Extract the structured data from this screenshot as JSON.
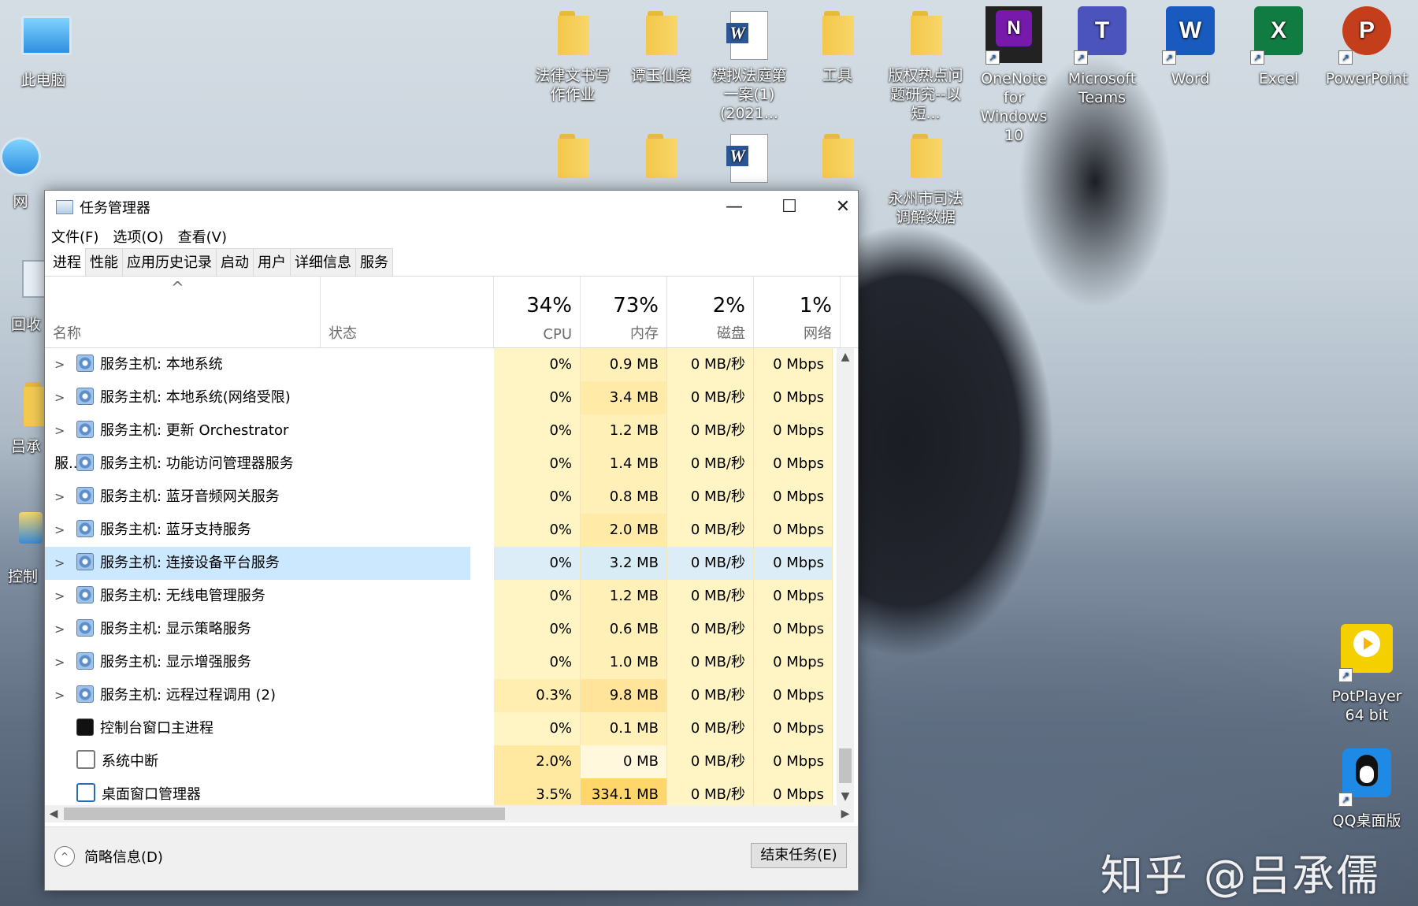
{
  "desktop": {
    "icons_left": [
      {
        "label": "此电脑"
      },
      {
        "label": "网"
      },
      {
        "label": "回收"
      },
      {
        "label": "吕承"
      },
      {
        "label": "控制"
      }
    ],
    "icons_top": [
      {
        "label": "法律文书写作作业",
        "type": "folder"
      },
      {
        "label": "谭玉仙案",
        "type": "folder"
      },
      {
        "label": "模拟法庭第一案(1) (2021...",
        "type": "word-doc"
      },
      {
        "label": "工具",
        "type": "folder"
      },
      {
        "label": "版权热点问题研究--以短...",
        "type": "folder"
      }
    ],
    "icons_row2": [
      {
        "label": "永州市司法调解数据",
        "type": "folder"
      }
    ],
    "apps": [
      {
        "label": "OneNote for Windows 10",
        "letter": "N",
        "color": "#7719aa"
      },
      {
        "label": "Microsoft Teams",
        "letter": "T",
        "color": "#4b53bc"
      },
      {
        "label": "Word",
        "letter": "W",
        "color": "#185abd"
      },
      {
        "label": "Excel",
        "letter": "X",
        "color": "#107c41"
      },
      {
        "label": "PowerPoint",
        "letter": "P",
        "color": "#c43e1c"
      }
    ],
    "right_icons": [
      {
        "label": "PotPlayer 64 bit"
      },
      {
        "label": "QQ桌面版"
      }
    ],
    "watermark": "知乎 @吕承儒"
  },
  "window": {
    "title": "任务管理器",
    "minimize": "—",
    "maximize": "☐",
    "close": "✕",
    "menu": [
      "文件(F)",
      "选项(O)",
      "查看(V)"
    ],
    "tabs": [
      "进程",
      "性能",
      "应用历史记录",
      "启动",
      "用户",
      "详细信息",
      "服务"
    ],
    "columns": {
      "name": "名称",
      "status": "状态",
      "cpu_pct": "34%",
      "cpu": "CPU",
      "mem_pct": "73%",
      "mem": "内存",
      "disk_pct": "2%",
      "disk": "磁盘",
      "net_pct": "1%",
      "net": "网络"
    },
    "rows": [
      {
        "name": "服务主机: 本地系统",
        "cpu": "0%",
        "mem": "0.9 MB",
        "disk": "0 MB/秒",
        "net": "0 Mbps"
      },
      {
        "name": "服务主机: 本地系统(网络受限)",
        "cpu": "0%",
        "mem": "3.4 MB",
        "disk": "0 MB/秒",
        "net": "0 Mbps"
      },
      {
        "name": "服务主机: 更新 Orchestrator 服...",
        "cpu": "0%",
        "mem": "1.2 MB",
        "disk": "0 MB/秒",
        "net": "0 Mbps"
      },
      {
        "name": "服务主机: 功能访问管理器服务",
        "cpu": "0%",
        "mem": "1.4 MB",
        "disk": "0 MB/秒",
        "net": "0 Mbps"
      },
      {
        "name": "服务主机: 蓝牙音频网关服务",
        "cpu": "0%",
        "mem": "0.8 MB",
        "disk": "0 MB/秒",
        "net": "0 Mbps"
      },
      {
        "name": "服务主机: 蓝牙支持服务",
        "cpu": "0%",
        "mem": "2.0 MB",
        "disk": "0 MB/秒",
        "net": "0 Mbps"
      },
      {
        "name": "服务主机: 连接设备平台服务",
        "cpu": "0%",
        "mem": "3.2 MB",
        "disk": "0 MB/秒",
        "net": "0 Mbps"
      },
      {
        "name": "服务主机: 无线电管理服务",
        "cpu": "0%",
        "mem": "1.2 MB",
        "disk": "0 MB/秒",
        "net": "0 Mbps"
      },
      {
        "name": "服务主机: 显示策略服务",
        "cpu": "0%",
        "mem": "0.6 MB",
        "disk": "0 MB/秒",
        "net": "0 Mbps"
      },
      {
        "name": "服务主机: 显示增强服务",
        "cpu": "0%",
        "mem": "1.0 MB",
        "disk": "0 MB/秒",
        "net": "0 Mbps"
      },
      {
        "name": "服务主机: 远程过程调用 (2)",
        "cpu": "0.3%",
        "mem": "9.8 MB",
        "disk": "0 MB/秒",
        "net": "0 Mbps"
      },
      {
        "name": "控制台窗口主进程",
        "cpu": "0%",
        "mem": "0.1 MB",
        "disk": "0 MB/秒",
        "net": "0 Mbps"
      },
      {
        "name": "系统中断",
        "cpu": "2.0%",
        "mem": "0 MB",
        "disk": "0 MB/秒",
        "net": "0 Mbps"
      },
      {
        "name": "桌面窗口管理器",
        "cpu": "3.5%",
        "mem": "334.1 MB",
        "disk": "0 MB/秒",
        "net": "0 Mbps"
      }
    ],
    "footer": {
      "fewer_details": "简略信息(D)",
      "end_task": "结束任务(E)"
    }
  }
}
